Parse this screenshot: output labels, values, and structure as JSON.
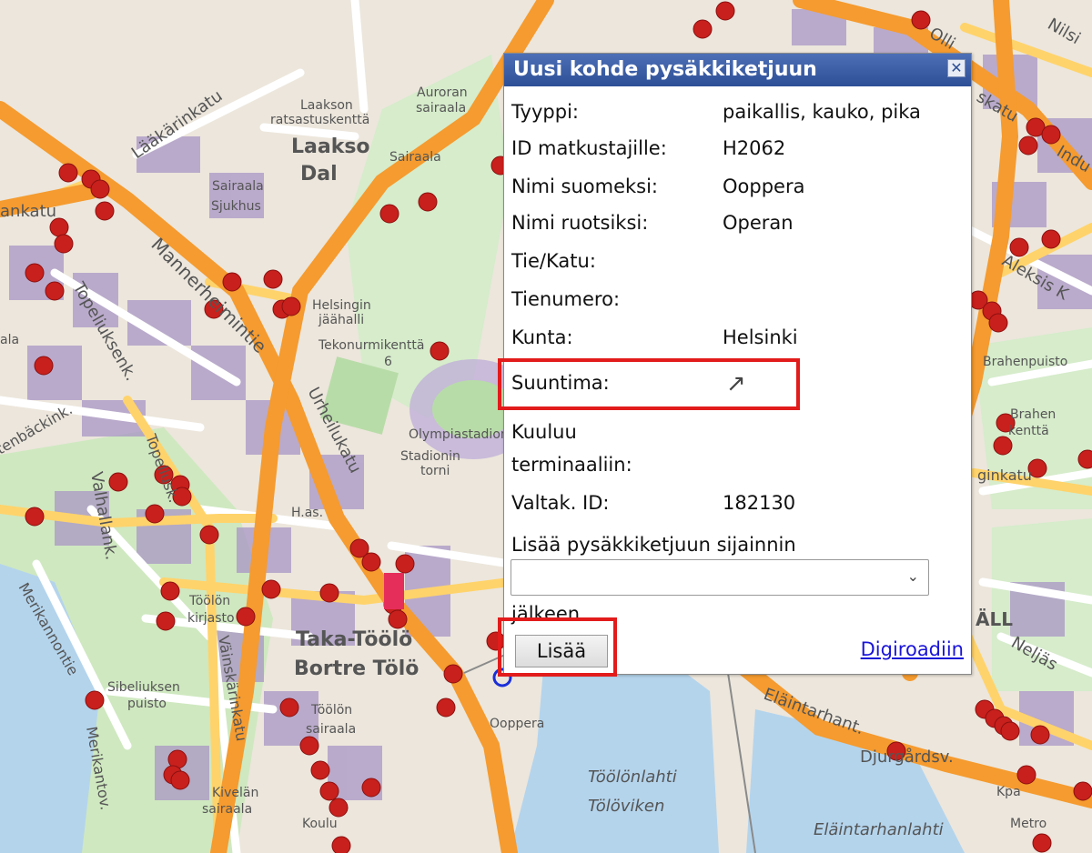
{
  "map": {
    "labels": {
      "laakson_ratsastuskentta_1": "Laakson",
      "laakson_ratsastuskentta_2": "ratsastuskenttä",
      "auroran_1": "Auroran",
      "auroran_2": "sairaala",
      "laakso": "Laakso",
      "dal": "Dal",
      "sairaala_small": "Sairaala",
      "sairaala_sjukhus_1": "Sairaala",
      "sairaala_sjukhus_2": "Sjukhus",
      "laakarinkatu": "Lääkärinkatu",
      "mannerheimintie": "Mannerheimintie",
      "topeliuksenk": "Topeliuksenk.",
      "tenbackink": "tenbäckink.",
      "helsingin_1": "Helsingin",
      "helsingin_2": "jäähalli",
      "tekonurmi_1": "Tekonurmikenttä",
      "tekonurmi_2": "6",
      "urheilukatu": "Urheilukatu",
      "olympiastadion": "Olympiastadion",
      "stadionin_1": "Stadionin",
      "stadionin_2": "torni",
      "valhallank": "Valhallank.",
      "toolonkatu": "Topeliusk.",
      "has": "H.as.",
      "merikannontie": "Merikannontie",
      "toolon_kirjasto_1": "Töölön",
      "toolon_kirjasto_2": "kirjasto",
      "taka_toolo": "Taka-Töölö",
      "bortre_tolo": "Bortre Tölö",
      "sibeliuksen_1": "Sibeliuksen",
      "sibeliuksen_2": "puisto",
      "valskarinkatu": "Väinskärinkatu",
      "toolon_sairaala_1": "Töölön",
      "toolon_sairaala_2": "sairaala",
      "merikantov": "Merikantov.",
      "kivelan_1": "Kivelän",
      "kivelan_2": "sairaala",
      "koulu": "Koulu",
      "oopperatalo": "Ooppera",
      "toolonlahti": "Töölönlahti",
      "toloviken": "Tölöviken",
      "elaintarhanlahti": "Eläintarhanlahti",
      "djurgardsv": "Djurgårdsv.",
      "elaintarhant": "Eläintarhant.",
      "brahenpuisto": "Brahenpuisto",
      "brahen_1": "Brahen",
      "brahen_2": "kenttä",
      "ginkatu": "ginkatu",
      "kpa": "Kpa",
      "metro": "Metro",
      "neljas": "Neljäs",
      "aleksis": "Aleksis K",
      "kenkatu": "ankatu",
      "ala": "ala",
      "nilsi": "Nilsi",
      "industri": "Indu",
      "olli": "Olli",
      "katu": "skatu",
      "all": "ÄLL"
    }
  },
  "popup": {
    "title": "Uusi kohde pysäkkiketjuun",
    "close_glyph": "✕",
    "fields": [
      {
        "label": "Tyyppi:",
        "value": "paikallis, kauko, pika"
      },
      {
        "label": "ID matkustajille:",
        "value": "H2062"
      },
      {
        "label": "Nimi suomeksi:",
        "value": "Ooppera"
      },
      {
        "label": "Nimi ruotsiksi:",
        "value": "Operan"
      },
      {
        "label": "Tie/Katu:",
        "value": ""
      },
      {
        "label": "Tienumero:",
        "value": ""
      },
      {
        "label": "Kunta:",
        "value": "Helsinki"
      },
      {
        "label": "Suuntima:",
        "value": "↗"
      },
      {
        "label": "Kuuluu",
        "value": ""
      },
      {
        "label": "terminaaliin:",
        "value": ""
      },
      {
        "label": "Valtak. ID:",
        "value": "182130"
      }
    ],
    "insert_label": "Lisää pysäkkiketjuun sijainnin",
    "select_value": "",
    "after_label": "jälkeen",
    "add_button": "Lisää",
    "digiroad_link": "Digiroadiin"
  },
  "icons": {
    "close": "close-icon",
    "direction": "arrow-up-right-icon",
    "dropdown": "chevron-down-icon"
  },
  "colors": {
    "header_blue": "#2d4f96",
    "highlight_red": "#e21b1b",
    "bus_stop_red": "#c8201c",
    "road_major": "#f7a334",
    "road_minor": "#ffd36b",
    "water": "#b4d4ec",
    "park": "#cfe8c0",
    "building": "#a996c6"
  }
}
